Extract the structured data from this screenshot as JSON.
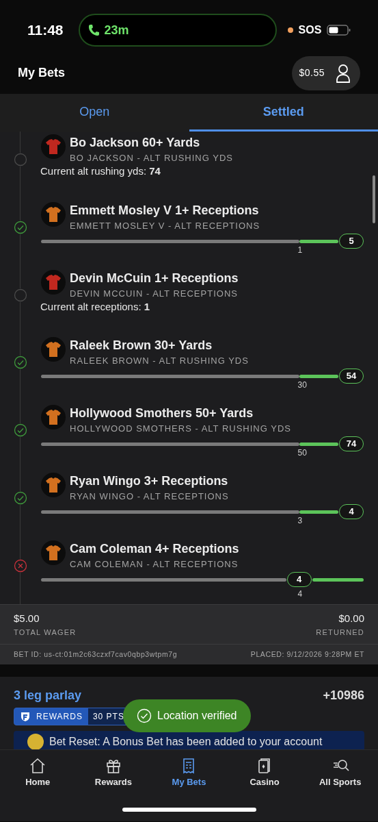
{
  "status_bar": {
    "time": "11:48",
    "call_duration": "23m",
    "carrier": "SOS"
  },
  "header": {
    "title": "My Bets",
    "balance": "$0.55"
  },
  "tabs": [
    {
      "label": "Open",
      "selected": false
    },
    {
      "label": "Settled",
      "selected": true
    }
  ],
  "legs": [
    {
      "title": "Bo Jackson 60+ Yards",
      "subtitle": "BO JACKSON - ALT RUSHING YDS",
      "settled": false,
      "color": "#c0281f",
      "kind": "current",
      "current_label": "Current alt rushing yds:",
      "current_value": "74"
    },
    {
      "title": "Emmett Mosley V 1+ Receptions",
      "subtitle": "EMMETT MOSLEY V - ALT RECEPTIONS",
      "settled": true,
      "won": true,
      "color": "#d2701f",
      "kind": "progress",
      "target": "1",
      "result": "5"
    },
    {
      "title": "Devin McCuin 1+ Receptions",
      "subtitle": "DEVIN MCCUIN - ALT RECEPTIONS",
      "settled": false,
      "color": "#c0281f",
      "kind": "current",
      "current_label": "Current alt receptions:",
      "current_value": "1"
    },
    {
      "title": "Raleek Brown 30+ Yards",
      "subtitle": "RALEEK BROWN - ALT RUSHING YDS",
      "settled": true,
      "won": true,
      "color": "#d2701f",
      "kind": "progress",
      "target": "30",
      "result": "54"
    },
    {
      "title": "Hollywood Smothers 50+ Yards",
      "subtitle": "HOLLYWOOD SMOTHERS - ALT RUSHING YDS",
      "settled": true,
      "won": true,
      "color": "#d2701f",
      "kind": "progress",
      "target": "50",
      "result": "74"
    },
    {
      "title": "Ryan Wingo 3+ Receptions",
      "subtitle": "RYAN WINGO - ALT RECEPTIONS",
      "settled": true,
      "won": true,
      "color": "#d2701f",
      "kind": "progress",
      "target": "3",
      "result": "4"
    },
    {
      "title": "Cam Coleman 4+ Receptions",
      "subtitle": "CAM COLEMAN - ALT RECEPTIONS",
      "settled": true,
      "won": false,
      "color": "#d2701f",
      "kind": "progress",
      "target": "4",
      "result": "4"
    }
  ],
  "summary": {
    "wager": "$5.00",
    "wager_label": "TOTAL WAGER",
    "returned": "$0.00",
    "returned_label": "RETURNED",
    "bet_id": "BET ID: us-ct:01m2c63czxf7cav0qbp3wtpm7g",
    "placed": "PLACED: 9/12/2026 9:28PM ET"
  },
  "parlay": {
    "title": "3 leg parlay",
    "odds": "+10986",
    "rewards_label": "REWARDS",
    "rewards_points": "30 PTS",
    "banner": "Bet Reset: A Bonus Bet has been added to your account"
  },
  "toast": "Location verified",
  "nav": [
    {
      "label": "Home",
      "selected": false
    },
    {
      "label": "Rewards",
      "selected": false
    },
    {
      "label": "My Bets",
      "selected": true
    },
    {
      "label": "Casino",
      "selected": false
    },
    {
      "label": "All Sports",
      "selected": false
    }
  ]
}
